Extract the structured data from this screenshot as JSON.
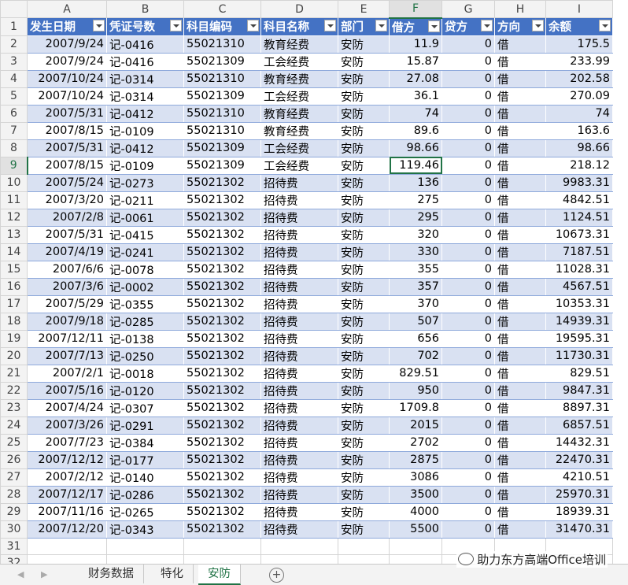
{
  "columns": [
    "A",
    "B",
    "C",
    "D",
    "E",
    "F",
    "G",
    "H",
    "I"
  ],
  "active_column": "F",
  "active_row": 9,
  "headers": [
    "发生日期",
    "凭证号数",
    "科目编码",
    "科目名称",
    "部门",
    "借方",
    "贷方",
    "方向",
    "余额"
  ],
  "rows": [
    {
      "num": "2",
      "cells": [
        "2007/9/24",
        "记-0416",
        "55021310",
        "教育经费",
        "安防",
        "11.9",
        "0",
        "借",
        "175.5"
      ]
    },
    {
      "num": "3",
      "cells": [
        "2007/9/24",
        "记-0416",
        "55021309",
        "工会经费",
        "安防",
        "15.87",
        "0",
        "借",
        "233.99"
      ]
    },
    {
      "num": "4",
      "cells": [
        "2007/10/24",
        "记-0314",
        "55021310",
        "教育经费",
        "安防",
        "27.08",
        "0",
        "借",
        "202.58"
      ]
    },
    {
      "num": "5",
      "cells": [
        "2007/10/24",
        "记-0314",
        "55021309",
        "工会经费",
        "安防",
        "36.1",
        "0",
        "借",
        "270.09"
      ]
    },
    {
      "num": "6",
      "cells": [
        "2007/5/31",
        "记-0412",
        "55021310",
        "教育经费",
        "安防",
        "74",
        "0",
        "借",
        "74"
      ]
    },
    {
      "num": "7",
      "cells": [
        "2007/8/15",
        "记-0109",
        "55021310",
        "教育经费",
        "安防",
        "89.6",
        "0",
        "借",
        "163.6"
      ]
    },
    {
      "num": "8",
      "cells": [
        "2007/5/31",
        "记-0412",
        "55021309",
        "工会经费",
        "安防",
        "98.66",
        "0",
        "借",
        "98.66"
      ]
    },
    {
      "num": "9",
      "cells": [
        "2007/8/15",
        "记-0109",
        "55021309",
        "工会经费",
        "安防",
        "119.46",
        "0",
        "借",
        "218.12"
      ]
    },
    {
      "num": "10",
      "cells": [
        "2007/5/24",
        "记-0273",
        "55021302",
        "招待费",
        "安防",
        "136",
        "0",
        "借",
        "9983.31"
      ]
    },
    {
      "num": "11",
      "cells": [
        "2007/3/20",
        "记-0211",
        "55021302",
        "招待费",
        "安防",
        "275",
        "0",
        "借",
        "4842.51"
      ]
    },
    {
      "num": "12",
      "cells": [
        "2007/2/8",
        "记-0061",
        "55021302",
        "招待费",
        "安防",
        "295",
        "0",
        "借",
        "1124.51"
      ]
    },
    {
      "num": "13",
      "cells": [
        "2007/5/31",
        "记-0415",
        "55021302",
        "招待费",
        "安防",
        "320",
        "0",
        "借",
        "10673.31"
      ]
    },
    {
      "num": "14",
      "cells": [
        "2007/4/19",
        "记-0241",
        "55021302",
        "招待费",
        "安防",
        "330",
        "0",
        "借",
        "7187.51"
      ]
    },
    {
      "num": "15",
      "cells": [
        "2007/6/6",
        "记-0078",
        "55021302",
        "招待费",
        "安防",
        "355",
        "0",
        "借",
        "11028.31"
      ]
    },
    {
      "num": "16",
      "cells": [
        "2007/3/6",
        "记-0002",
        "55021302",
        "招待费",
        "安防",
        "357",
        "0",
        "借",
        "4567.51"
      ]
    },
    {
      "num": "17",
      "cells": [
        "2007/5/29",
        "记-0355",
        "55021302",
        "招待费",
        "安防",
        "370",
        "0",
        "借",
        "10353.31"
      ]
    },
    {
      "num": "18",
      "cells": [
        "2007/9/18",
        "记-0285",
        "55021302",
        "招待费",
        "安防",
        "507",
        "0",
        "借",
        "14939.31"
      ]
    },
    {
      "num": "19",
      "cells": [
        "2007/12/11",
        "记-0138",
        "55021302",
        "招待费",
        "安防",
        "656",
        "0",
        "借",
        "19595.31"
      ]
    },
    {
      "num": "20",
      "cells": [
        "2007/7/13",
        "记-0250",
        "55021302",
        "招待费",
        "安防",
        "702",
        "0",
        "借",
        "11730.31"
      ]
    },
    {
      "num": "21",
      "cells": [
        "2007/2/1",
        "记-0018",
        "55021302",
        "招待费",
        "安防",
        "829.51",
        "0",
        "借",
        "829.51"
      ]
    },
    {
      "num": "22",
      "cells": [
        "2007/5/16",
        "记-0120",
        "55021302",
        "招待费",
        "安防",
        "950",
        "0",
        "借",
        "9847.31"
      ]
    },
    {
      "num": "23",
      "cells": [
        "2007/4/24",
        "记-0307",
        "55021302",
        "招待费",
        "安防",
        "1709.8",
        "0",
        "借",
        "8897.31"
      ]
    },
    {
      "num": "24",
      "cells": [
        "2007/3/26",
        "记-0291",
        "55021302",
        "招待费",
        "安防",
        "2015",
        "0",
        "借",
        "6857.51"
      ]
    },
    {
      "num": "25",
      "cells": [
        "2007/7/23",
        "记-0384",
        "55021302",
        "招待费",
        "安防",
        "2702",
        "0",
        "借",
        "14432.31"
      ]
    },
    {
      "num": "26",
      "cells": [
        "2007/12/12",
        "记-0177",
        "55021302",
        "招待费",
        "安防",
        "2875",
        "0",
        "借",
        "22470.31"
      ]
    },
    {
      "num": "27",
      "cells": [
        "2007/2/12",
        "记-0140",
        "55021302",
        "招待费",
        "安防",
        "3086",
        "0",
        "借",
        "4210.51"
      ]
    },
    {
      "num": "28",
      "cells": [
        "2007/12/17",
        "记-0286",
        "55021302",
        "招待费",
        "安防",
        "3500",
        "0",
        "借",
        "25970.31"
      ]
    },
    {
      "num": "29",
      "cells": [
        "2007/11/16",
        "记-0265",
        "55021302",
        "招待费",
        "安防",
        "4000",
        "0",
        "借",
        "18939.31"
      ]
    },
    {
      "num": "30",
      "cells": [
        "2007/12/20",
        "记-0343",
        "55021302",
        "招待费",
        "安防",
        "5500",
        "0",
        "借",
        "31470.31"
      ]
    }
  ],
  "empty_rows": [
    "31",
    "32"
  ],
  "header_row_num": "1",
  "tabs": {
    "sheets": [
      "财务数据",
      "特化",
      "安防"
    ],
    "active": "安防",
    "add_symbol": "+"
  },
  "watermark": "助力东方高端Office培训",
  "colors": {
    "header_fill": "#4472c4",
    "band_fill": "#d9e1f2",
    "accent": "#217346"
  }
}
